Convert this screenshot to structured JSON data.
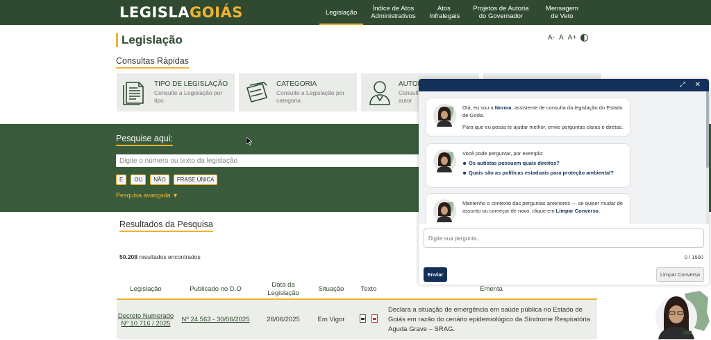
{
  "header": {
    "logo_part1": "LEGISLA",
    "logo_part2": "GOIÁS",
    "nav": [
      {
        "label": "Legislação"
      },
      {
        "label": "Índice de Atos Administrativos"
      },
      {
        "label": "Atos Infralegais"
      },
      {
        "label": "Projetos de Autoria do Governador"
      },
      {
        "label": "Mensagem de Veto"
      }
    ]
  },
  "page": {
    "title": "Legislação",
    "font_tools": {
      "decrease": "A-",
      "normal": "A",
      "increase": "A+"
    }
  },
  "quick": {
    "title": "Consultas Rápidas",
    "cards": [
      {
        "title": "TIPO DE LEGISLAÇÃO",
        "subtitle": "Consulte a Legislação por tipo"
      },
      {
        "title": "CATEGORIA",
        "subtitle": "Consulte a Legislação por categoria"
      },
      {
        "title": "AUTOR",
        "subtitle": "Consulte a Legislação por autor"
      }
    ]
  },
  "search": {
    "title": "Pesquise aqui:",
    "placeholder": "Digite o número ou texto da legislação",
    "operators": [
      "E",
      "OU",
      "NÃO",
      "FRASE ÚNICA"
    ],
    "advanced": "Pesquisa avançada ▼"
  },
  "results": {
    "title": "Resultados da Pesquisa",
    "count": "50.208",
    "count_suffix": " resultados encontrados",
    "columns": {
      "legislacao": "Legislação",
      "publicado": "Publicado no D.O",
      "data": "Data da Legislação",
      "situacao": "Situação",
      "texto": "Texto",
      "ementa": "Ementa"
    },
    "rows": [
      {
        "legislacao": "Decreto Numerado Nº 10.716 / 2025",
        "publicado": "Nº 24.563 - 30/06/2025",
        "data": "26/06/2025",
        "situacao": "Em Vigor",
        "ementa": "Declara a situação de emergência em saúde pública no Estado de Goiás em razão do cenário epidemiológico da Síndrome Respiratória Aguda Grave – SRAG."
      }
    ]
  },
  "chat": {
    "messages": {
      "m1_pre": "Olá, eu sou a ",
      "m1_name": "Norma",
      "m1_post": ", assistente de consulta da legislação do Estado de Goiás.",
      "m1_line2": "Para que eu possa te ajudar melhor, envie perguntas claras e diretas.",
      "m2_intro": "Você pode perguntar, por exemplo:",
      "m2_examples": [
        "Os autistas possuem quais direitos?",
        "Quais são as políticas estaduais para proteção ambiental?"
      ],
      "m3_pre": "Mantenho o contexto das perguntas anteriores — se quiser mudar de assunto ou começar de novo, clique em ",
      "m3_link": "Limpar Conversa",
      "m3_post": "."
    },
    "input_placeholder": "Digite sua pergunta...",
    "counter": "0 / 1500",
    "send_label": "Enviar",
    "clear_label": "Limpar Conversa"
  },
  "colors": {
    "brand_green": "#2f4a30",
    "accent_gold": "#f0b232",
    "chat_navy": "#123058"
  }
}
